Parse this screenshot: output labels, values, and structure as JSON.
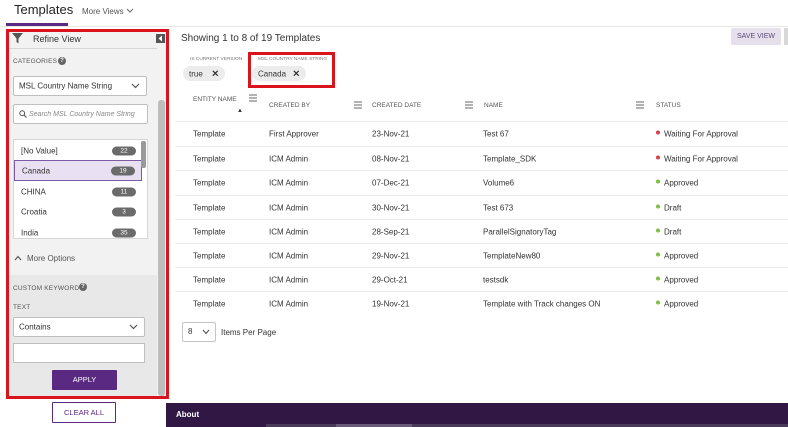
{
  "header": {
    "tab_title": "Templates",
    "more_views": "More Views"
  },
  "left_panel": {
    "refine_title": "Refine View",
    "categories_label": "CATEGORIES",
    "category_select": "MSL Country Name String",
    "search_placeholder": "Search MSL Country Name String",
    "items": [
      {
        "label": "[No Value]",
        "count": "22"
      },
      {
        "label": "Canada",
        "count": "19"
      },
      {
        "label": "CHINA",
        "count": "11"
      },
      {
        "label": "Croatia",
        "count": "3"
      },
      {
        "label": "India",
        "count": "35"
      }
    ],
    "more_options": "More Options",
    "custom_keyword_label": "CUSTOM KEYWORD",
    "text_label": "TEXT",
    "operator_select": "Contains",
    "text_value": "",
    "apply": "APPLY",
    "clear_all": "CLEAR ALL"
  },
  "main": {
    "showing": "Showing 1 to 8 of 19 Templates",
    "save_view": "SAVE VIEW",
    "filters": [
      {
        "label": "IS CURRENT VERSION",
        "value": "true"
      },
      {
        "label": "MSL COUNTRY NAME STRING",
        "value": "Canada"
      }
    ],
    "columns": [
      "ENTITY NAME",
      "CREATED BY",
      "CREATED DATE",
      "NAME",
      "STATUS"
    ],
    "rows": [
      {
        "entity": "Template",
        "created_by": "First Approver",
        "created_date": "23-Nov-21",
        "name": "Test 67",
        "status": "Waiting For Approval",
        "status_color": "#d9414a"
      },
      {
        "entity": "Template",
        "created_by": "ICM Admin",
        "created_date": "08-Nov-21",
        "name": "Template_SDK",
        "status": "Waiting For Approval",
        "status_color": "#d9414a"
      },
      {
        "entity": "Template",
        "created_by": "ICM Admin",
        "created_date": "07-Dec-21",
        "name": "Volume6",
        "status": "Approved",
        "status_color": "#7cc142"
      },
      {
        "entity": "Template",
        "created_by": "ICM Admin",
        "created_date": "30-Nov-21",
        "name": "Test 673",
        "status": "Draft",
        "status_color": "#7cc142"
      },
      {
        "entity": "Template",
        "created_by": "ICM Admin",
        "created_date": "28-Sep-21",
        "name": "ParallelSignatoryTag",
        "status": "Draft",
        "status_color": "#7cc142"
      },
      {
        "entity": "Template",
        "created_by": "ICM Admin",
        "created_date": "29-Nov-21",
        "name": "TemplateNew80",
        "status": "Approved",
        "status_color": "#7cc142"
      },
      {
        "entity": "Template",
        "created_by": "ICM Admin",
        "created_date": "29-Oct-21",
        "name": "testsdk",
        "status": "Approved",
        "status_color": "#7cc142"
      },
      {
        "entity": "Template",
        "created_by": "ICM Admin",
        "created_date": "19-Nov-21",
        "name": "Template with Track changes ON",
        "status": "Approved",
        "status_color": "#7cc142"
      }
    ],
    "items_per_page_value": "8",
    "items_per_page_label": "Items Per Page"
  },
  "footer": {
    "about": "About"
  },
  "colors": {
    "brand_purple": "#5a2a82",
    "highlight_red": "#d9141c",
    "footer_bg": "#311844"
  }
}
